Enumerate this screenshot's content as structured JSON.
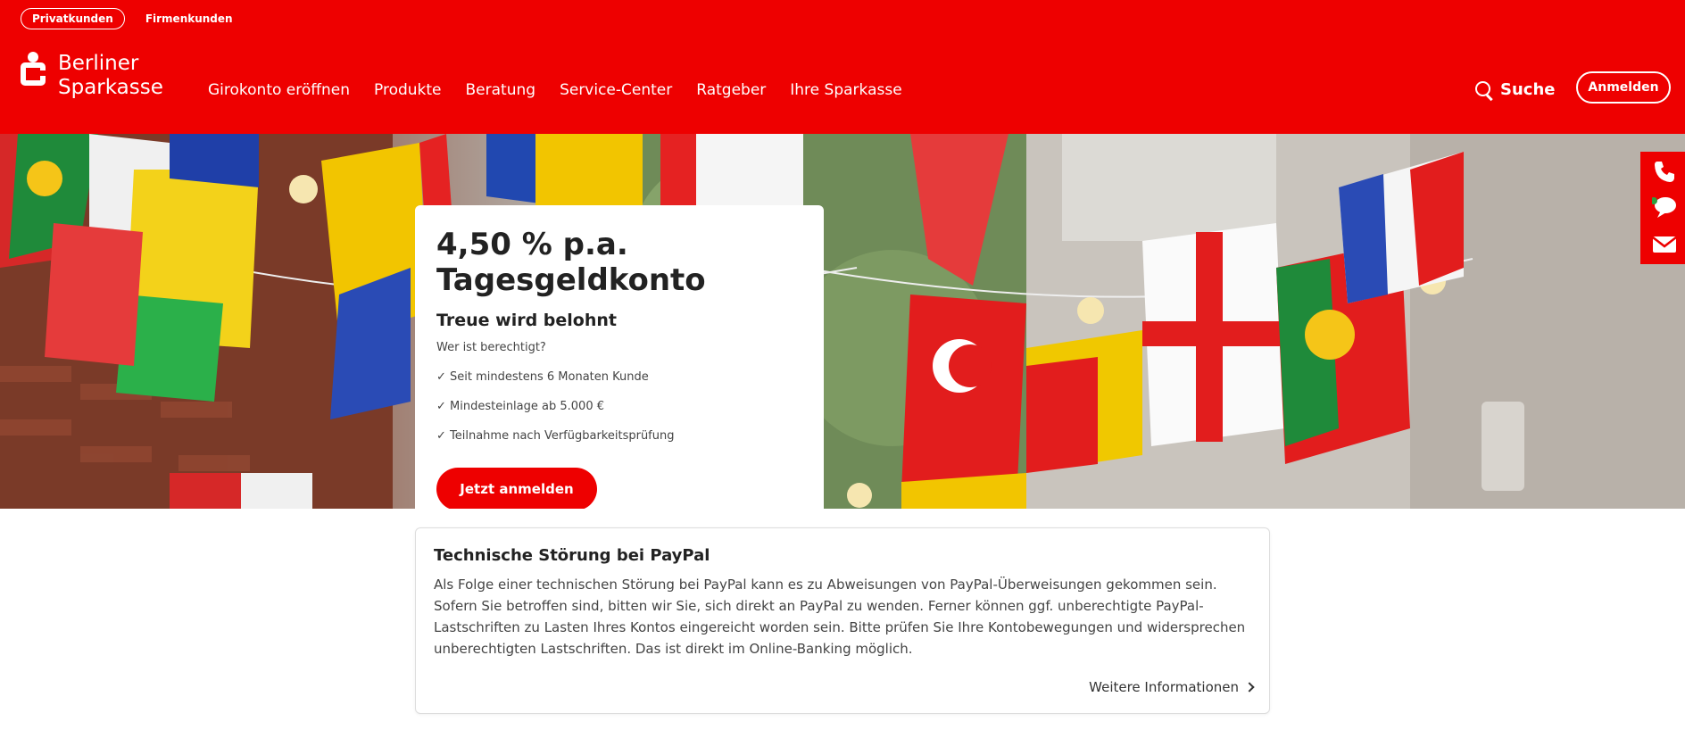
{
  "top_segments": [
    "Privatkunden",
    "Firmenkunden"
  ],
  "logo": {
    "line1": "Berliner",
    "line2": "Sparkasse"
  },
  "nav": [
    "Girokonto eröffnen",
    "Produkte",
    "Beratung",
    "Service-Center",
    "Ratgeber",
    "Ihre Sparkasse"
  ],
  "search_label": "Suche",
  "login_label": "Anmelden",
  "promo": {
    "title_line1": "4,50 % p.a.",
    "title_line2": "Tagesgeldkonto",
    "subtitle": "Treue wird belohnt",
    "question": "Wer ist berechtigt?",
    "items": [
      "✓ Seit mindestens 6 Monaten Kunde",
      "✓ Mindesteinlage ab 5.000 €",
      "✓ Teilnahme nach Verfügbarkeitsprüfung"
    ],
    "cta": "Jetzt anmelden"
  },
  "contact_icons": [
    "phone-icon",
    "chat-icon",
    "mail-icon"
  ],
  "notice": {
    "title": "Technische Störung bei PayPal",
    "body": "Als Folge einer technischen Störung bei PayPal kann es zu Abweisungen von PayPal-Überweisungen gekommen sein. Sofern Sie betroffen sind, bitten wir Sie, sich direkt an PayPal zu wenden. Ferner können ggf. unberechtigte PayPal-Lastschriften zu Lasten Ihres Kontos eingereicht worden sein. Bitte prüfen Sie Ihre Kontobewegungen und widersprechen unberechtigten Lastschriften. Das ist direkt im Online-Banking möglich.",
    "link": "Weitere Informationen"
  },
  "colors": {
    "brand_red": "#ee0000",
    "text_dark": "#222222",
    "online_dot": "#2e9e3e"
  }
}
